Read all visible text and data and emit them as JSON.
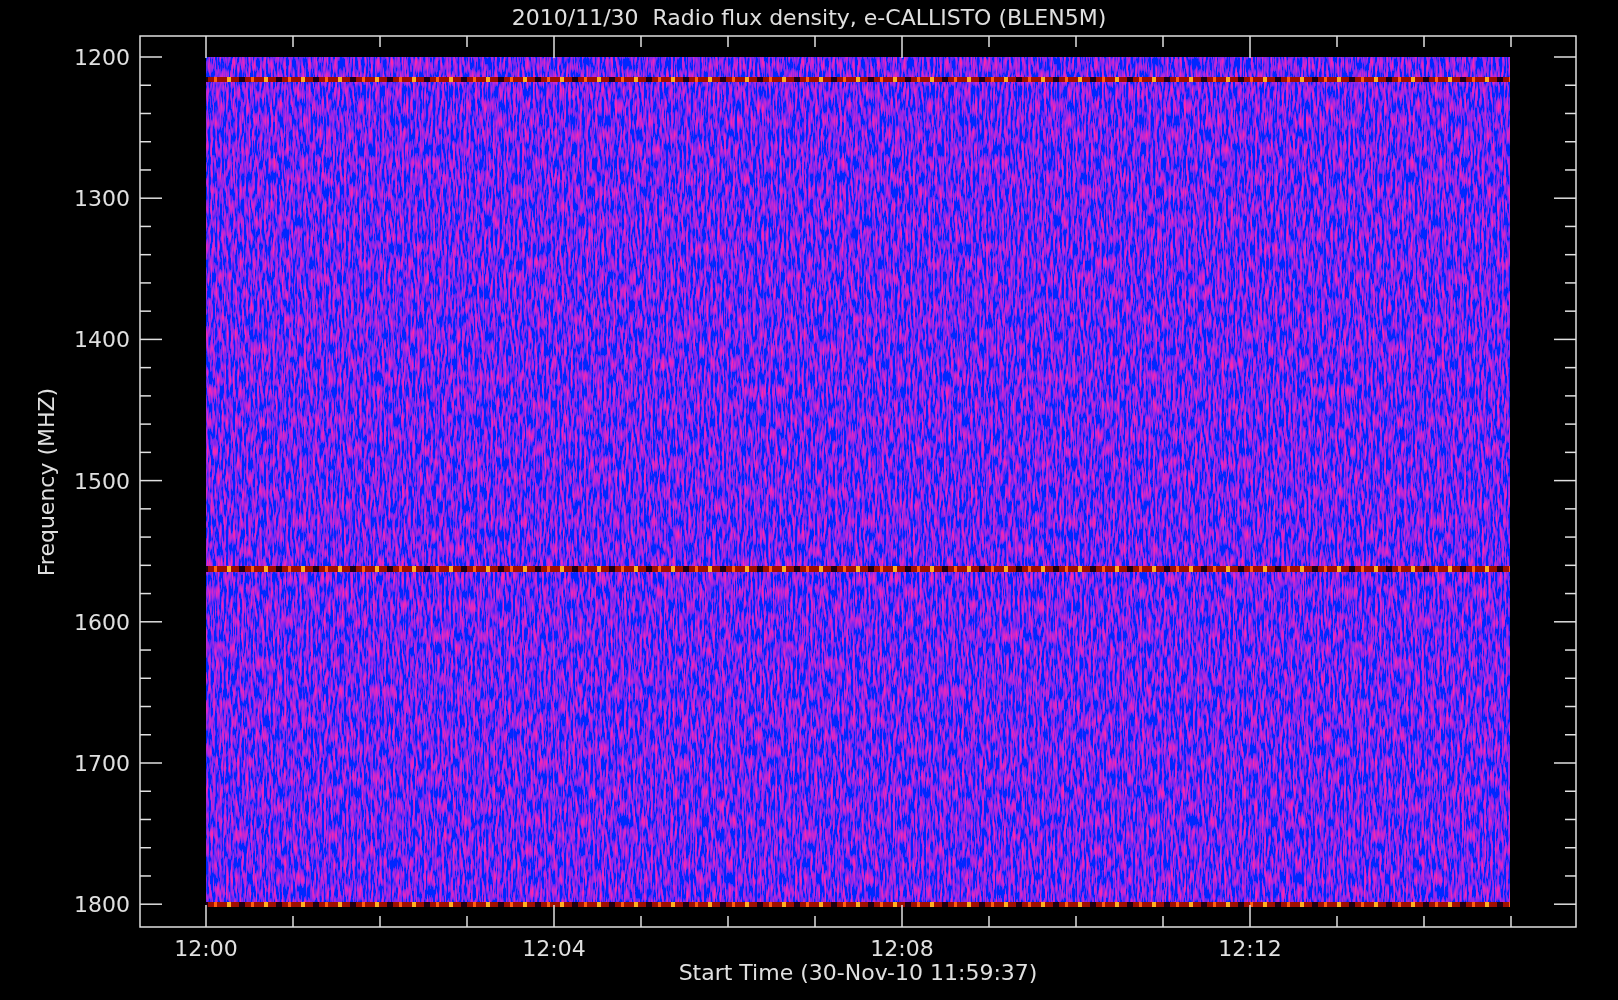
{
  "title": "2010/11/30  Radio flux density, e-CALLISTO (BLEN5M)",
  "y_axis": {
    "label": "Frequency (MHZ)",
    "ticks": [
      "1200",
      "1300",
      "1400",
      "1500",
      "1600",
      "1700",
      "1800"
    ]
  },
  "x_axis": {
    "label": "Start Time (30-Nov-10 11:59:37)",
    "ticks": [
      "12:00",
      "12:04",
      "12:08",
      "12:12"
    ]
  }
}
